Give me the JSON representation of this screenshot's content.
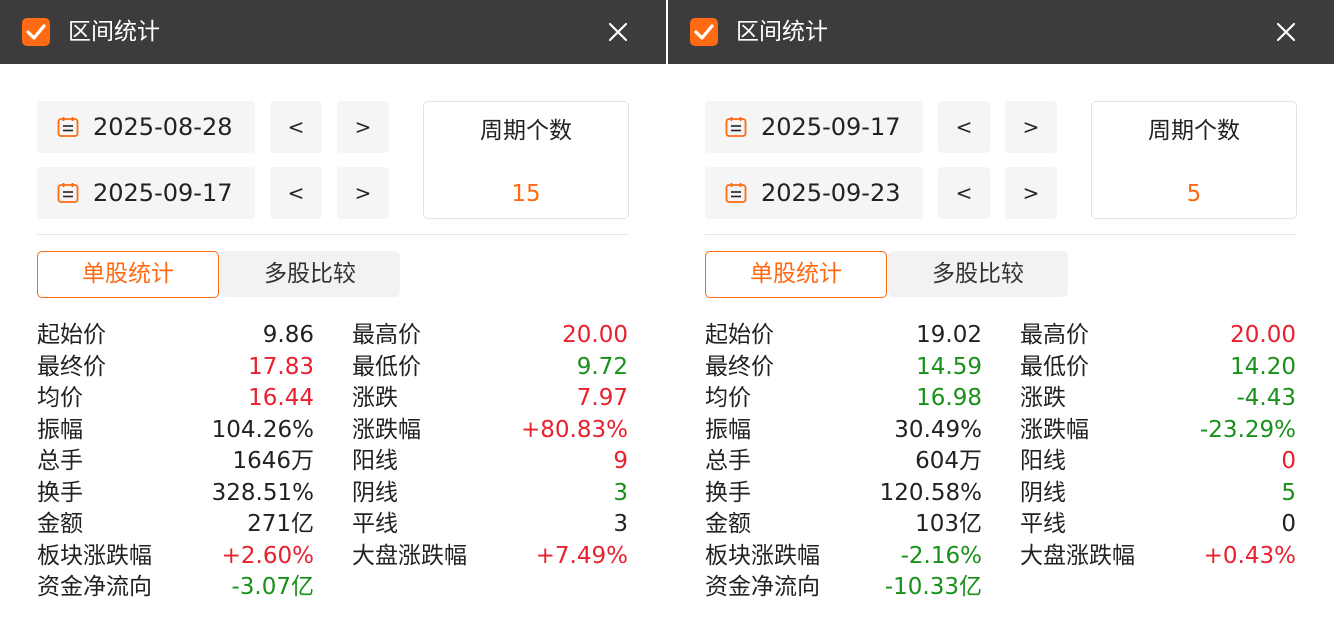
{
  "panels": [
    {
      "title": "区间统计",
      "start_date": "2025-08-28",
      "end_date": "2025-09-17",
      "prev_label": "<",
      "next_label": ">",
      "period_label": "周期个数",
      "period_value": "15",
      "tab_active": "单股统计",
      "tab_inactive": "多股比较",
      "left_stats": [
        {
          "label": "起始价",
          "value": "9.86",
          "color": "#222222"
        },
        {
          "label": "最终价",
          "value": "17.83",
          "color": "#e8212f"
        },
        {
          "label": "均价",
          "value": "16.44",
          "color": "#e8212f"
        },
        {
          "label": "振幅",
          "value": "104.26%",
          "color": "#222222"
        },
        {
          "label": "总手",
          "value": "1646万",
          "color": "#222222"
        },
        {
          "label": "换手",
          "value": "328.51%",
          "color": "#222222"
        },
        {
          "label": "金额",
          "value": "271亿",
          "color": "#222222"
        },
        {
          "label": "板块涨跌幅",
          "value": "+2.60%",
          "color": "#e8212f"
        },
        {
          "label": "资金净流向",
          "value": "-3.07亿",
          "color": "#199019"
        }
      ],
      "right_stats": [
        {
          "label": "最高价",
          "value": "20.00",
          "color": "#e8212f"
        },
        {
          "label": "最低价",
          "value": "9.72",
          "color": "#199019"
        },
        {
          "label": "涨跌",
          "value": "7.97",
          "color": "#e8212f"
        },
        {
          "label": "涨跌幅",
          "value": "+80.83%",
          "color": "#e8212f"
        },
        {
          "label": "阳线",
          "value": "9",
          "color": "#e8212f"
        },
        {
          "label": "阴线",
          "value": "3",
          "color": "#199019"
        },
        {
          "label": "平线",
          "value": "3",
          "color": "#222222"
        },
        {
          "label": "大盘涨跌幅",
          "value": "+7.49%",
          "color": "#e8212f"
        }
      ]
    },
    {
      "title": "区间统计",
      "start_date": "2025-09-17",
      "end_date": "2025-09-23",
      "prev_label": "<",
      "next_label": ">",
      "period_label": "周期个数",
      "period_value": "5",
      "tab_active": "单股统计",
      "tab_inactive": "多股比较",
      "left_stats": [
        {
          "label": "起始价",
          "value": "19.02",
          "color": "#222222"
        },
        {
          "label": "最终价",
          "value": "14.59",
          "color": "#199019"
        },
        {
          "label": "均价",
          "value": "16.98",
          "color": "#199019"
        },
        {
          "label": "振幅",
          "value": "30.49%",
          "color": "#222222"
        },
        {
          "label": "总手",
          "value": "604万",
          "color": "#222222"
        },
        {
          "label": "换手",
          "value": "120.58%",
          "color": "#222222"
        },
        {
          "label": "金额",
          "value": "103亿",
          "color": "#222222"
        },
        {
          "label": "板块涨跌幅",
          "value": "-2.16%",
          "color": "#199019"
        },
        {
          "label": "资金净流向",
          "value": "-10.33亿",
          "color": "#199019"
        }
      ],
      "right_stats": [
        {
          "label": "最高价",
          "value": "20.00",
          "color": "#e8212f"
        },
        {
          "label": "最低价",
          "value": "14.20",
          "color": "#199019"
        },
        {
          "label": "涨跌",
          "value": "-4.43",
          "color": "#199019"
        },
        {
          "label": "涨跌幅",
          "value": "-23.29%",
          "color": "#199019"
        },
        {
          "label": "阳线",
          "value": "0",
          "color": "#e8212f"
        },
        {
          "label": "阴线",
          "value": "5",
          "color": "#199019"
        },
        {
          "label": "平线",
          "value": "0",
          "color": "#222222"
        },
        {
          "label": "大盘涨跌幅",
          "value": "+0.43%",
          "color": "#e8212f"
        }
      ]
    }
  ],
  "icons": {
    "app": "checkbox-icon",
    "close": "close-icon",
    "calendar": "calendar-icon"
  },
  "colors": {
    "accent": "#ff6a13",
    "titlebar": "#3c3c3c",
    "up": "#e8212f",
    "down": "#199019"
  }
}
